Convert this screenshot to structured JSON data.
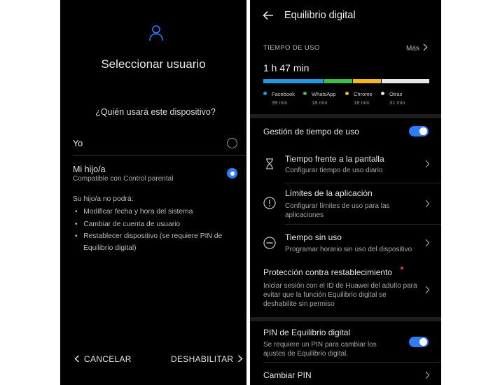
{
  "left": {
    "title": "Seleccionar usuario",
    "question": "¿Quién usará este dispositivo?",
    "options": [
      {
        "label": "Yo",
        "selected": false
      },
      {
        "label": "Mi hijo/a",
        "sublabel": "Compatible con Control parental",
        "selected": true
      }
    ],
    "restrictions_title": "Su hijo/a no podrá:",
    "restrictions": [
      "Modificar fecha y hora del sistema",
      "Cambiar de cuenta de usuario",
      "Restablecer dispositivo (se requiere PIN de",
      "Equilibrio digital)"
    ],
    "cancel_label": "CANCELAR",
    "disable_label": "DESHABILITAR"
  },
  "right": {
    "title": "Equilibrio digital",
    "usage_label": "TIEMPO DE USO",
    "more_label": "Más",
    "total_time": "1 h 47 min",
    "usage": [
      {
        "name": "Facebook",
        "time": "39 min",
        "minutes": 39,
        "color": "#1e9be3"
      },
      {
        "name": "WhatsApp",
        "time": "18 min",
        "minutes": 18,
        "color": "#3cc04a"
      },
      {
        "name": "Chrome",
        "time": "18 min",
        "minutes": 18,
        "color": "#f2b61e"
      },
      {
        "name": "Otras",
        "time": "31 min",
        "minutes": 31,
        "color": "#e6e6e6"
      }
    ],
    "management_label": "Gestión de tiempo de uso",
    "management_on": true,
    "items": [
      {
        "title": "Tiempo frente a la pantalla",
        "subtitle": "Configurar tiempo de uso diario",
        "icon": "hourglass-icon"
      },
      {
        "title": "Límites de la aplicación",
        "subtitle": "Configurar límites de uso para las aplicaciones",
        "icon": "alert-circle-icon"
      },
      {
        "title": "Tiempo sin uso",
        "subtitle": "Programar horario sin uso del dispositivo",
        "icon": "minus-circle-icon"
      }
    ],
    "protection": {
      "title": "Protección contra restablecimiento",
      "subtitle": "Iniciar sesión con el ID de Huawei del adulto para evitar que la función Equilibrio digital se deshabilite sin permiso"
    },
    "pin": {
      "title": "PIN de Equilibrio digital",
      "subtitle": "Se requiere un PIN para cambiar los ajustes de Equilibrio digital.",
      "on": true
    },
    "change_pin_label": "Cambiar PIN"
  },
  "colors": {
    "accent": "#2f7cf6",
    "background": "#000000"
  }
}
